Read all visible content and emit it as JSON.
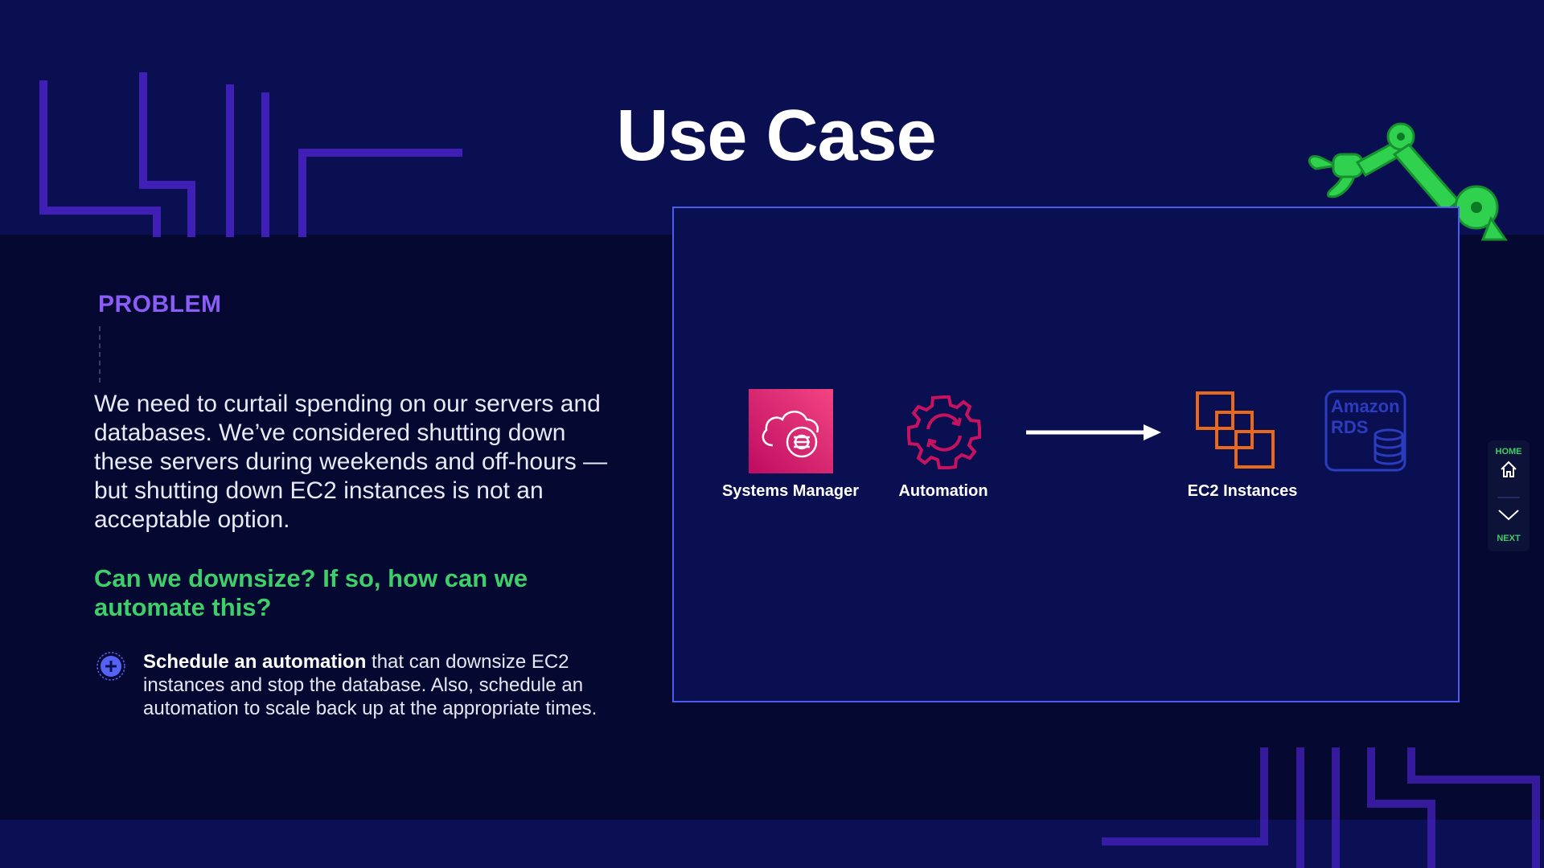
{
  "slide": {
    "title": "Use Case"
  },
  "problem": {
    "label": "PROBLEM",
    "text": "We need to curtail spending on our servers and databases. We’ve considered shutting down these servers during weekends and off-hours — but shutting down EC2 instances is not an acceptable option.",
    "question": "Can we downsize? If so, how can we automate this?",
    "bullet": {
      "bold": "Schedule an automation",
      "rest": " that can downsize EC2 instances and stop the database. Also, schedule an automation to scale back up at the appropriate times."
    }
  },
  "diagram": {
    "services": [
      {
        "label": "Systems Manager",
        "icon": "systems-manager-icon",
        "color": "#e7157b"
      },
      {
        "label": "Automation",
        "icon": "automation-icon",
        "color": "#c7135f"
      },
      {
        "label": "EC2 Instances",
        "icon": "ec2-instances-icon",
        "color": "#e8691a"
      }
    ],
    "rds_icon": {
      "line1": "Amazon",
      "line2": "RDS",
      "color": "#2b3cbf"
    }
  },
  "nav": {
    "home_label": "HOME",
    "next_label": "NEXT"
  },
  "colors": {
    "background": "#0a0f52",
    "accent_purple": "#8b5cf6",
    "accent_green": "#3ecf6a",
    "box_border": "#4e5df0"
  }
}
